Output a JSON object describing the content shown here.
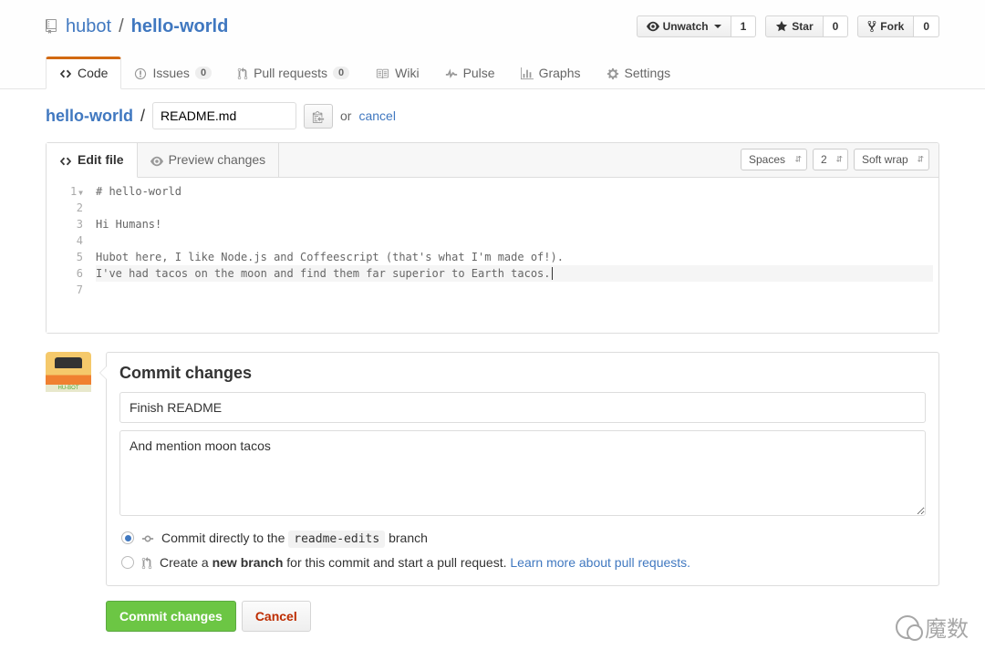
{
  "repo": {
    "owner": "hubot",
    "name": "hello-world"
  },
  "actions": {
    "watch": {
      "label": "Unwatch",
      "count": "1"
    },
    "star": {
      "label": "Star",
      "count": "0"
    },
    "fork": {
      "label": "Fork",
      "count": "0"
    }
  },
  "nav": {
    "code": "Code",
    "issues": {
      "label": "Issues",
      "count": "0"
    },
    "pulls": {
      "label": "Pull requests",
      "count": "0"
    },
    "wiki": "Wiki",
    "pulse": "Pulse",
    "graphs": "Graphs",
    "settings": "Settings"
  },
  "breadcrumb": {
    "repo_link": "hello-world",
    "filename": "README.md",
    "or": "or",
    "cancel": "cancel"
  },
  "editor_tabs": {
    "edit": "Edit file",
    "preview": "Preview changes"
  },
  "editor_settings": {
    "indent": "Spaces",
    "size": "2",
    "wrap": "Soft wrap"
  },
  "code_lines": [
    "# hello-world",
    "",
    "Hi Humans!",
    "",
    "Hubot here, I like Node.js and Coffeescript (that's what I'm made of!).",
    "I've had tacos on the moon and find them far superior to Earth tacos."
  ],
  "line_numbers": [
    "1",
    "2",
    "3",
    "4",
    "5",
    "6",
    "7"
  ],
  "commit": {
    "heading": "Commit changes",
    "summary": "Finish README",
    "description": "And mention moon tacos",
    "opt1_prefix": "Commit directly to the ",
    "opt1_branch": "readme-edits",
    "opt1_suffix": " branch",
    "opt2_prefix": "Create a ",
    "opt2_bold": "new branch",
    "opt2_suffix": " for this commit and start a pull request. ",
    "opt2_link": "Learn more about pull requests.",
    "submit": "Commit changes",
    "cancel": "Cancel"
  },
  "watermark": "魔数"
}
